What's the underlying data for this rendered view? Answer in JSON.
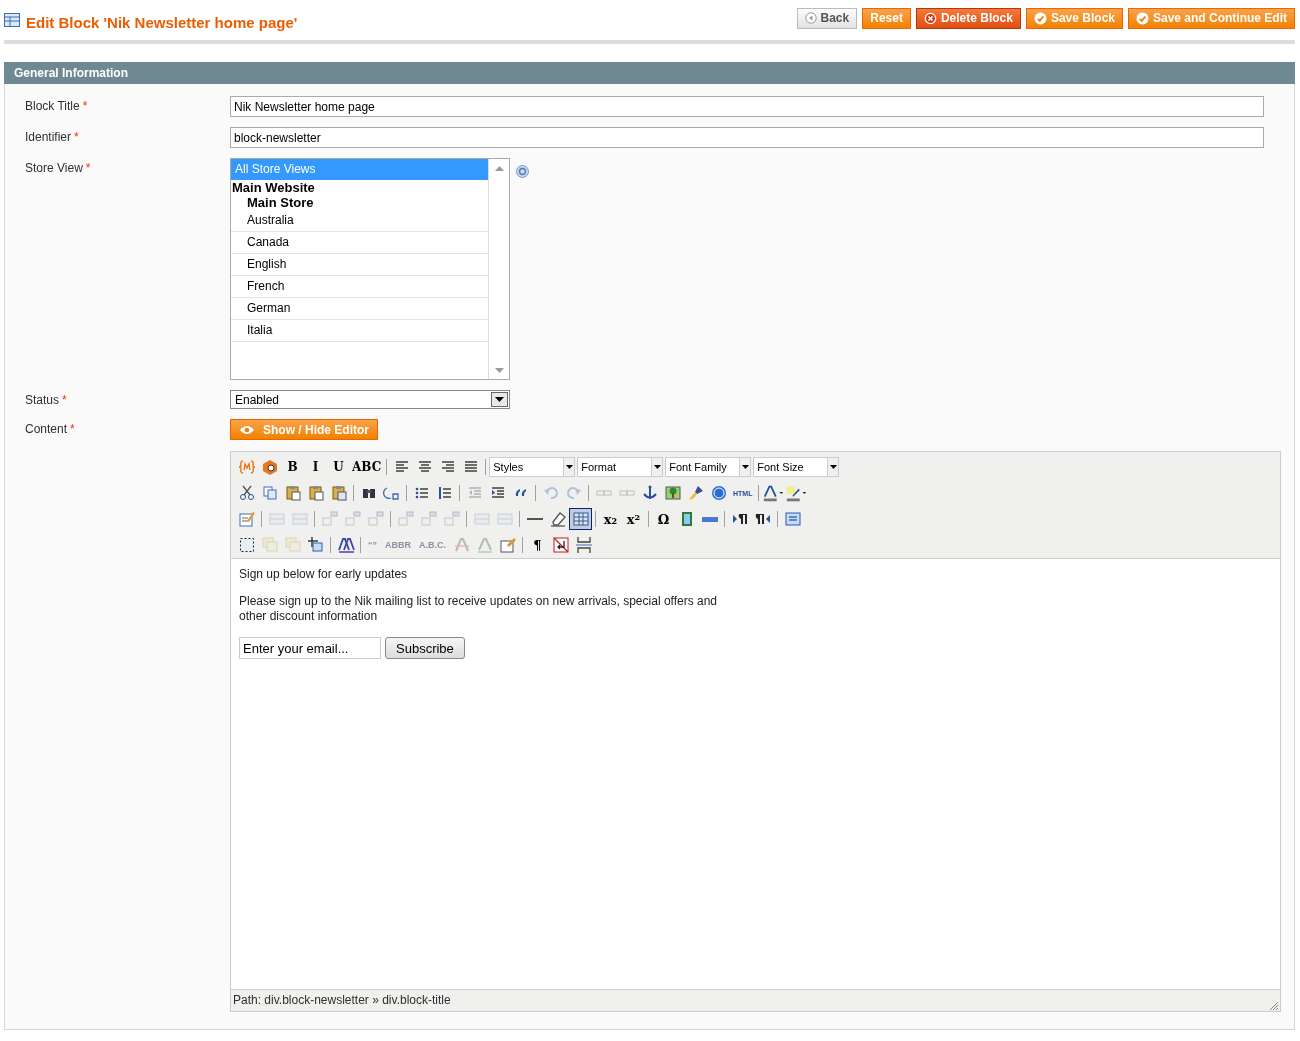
{
  "header": {
    "title": "Edit Block 'Nik Newsletter home page'",
    "buttons": [
      {
        "kind": "back",
        "label": "Back"
      },
      {
        "kind": "plain",
        "label": "Reset"
      },
      {
        "kind": "delete",
        "label": "Delete Block"
      },
      {
        "kind": "save",
        "label": "Save Block"
      },
      {
        "kind": "save",
        "label": "Save and Continue Edit"
      }
    ]
  },
  "section": {
    "title": "General Information"
  },
  "fields": [
    {
      "kind": "text",
      "label": "Block Title",
      "mark": "*",
      "value": "Nik Newsletter home page"
    },
    {
      "kind": "text",
      "label": "Identifier",
      "mark": "*",
      "value": "block-newsletter"
    },
    {
      "kind": "listbox",
      "label": "Store View",
      "mark": "*",
      "options": [
        {
          "label": "All Store Views",
          "selected": true
        },
        {
          "label": "Main Website",
          "children": [
            {
              "label": "Main Store",
              "children": [
                {
                  "label": "Australia",
                  "selected": false
                },
                {
                  "label": "Canada",
                  "selected": false
                },
                {
                  "label": "English",
                  "selected": false
                },
                {
                  "label": "French",
                  "selected": false
                },
                {
                  "label": "German",
                  "selected": false
                },
                {
                  "label": "Italia",
                  "selected": false
                }
              ]
            }
          ]
        }
      ]
    },
    {
      "kind": "select",
      "label": "Status",
      "mark": "*",
      "value": "Enabled"
    },
    {
      "kind": "editor",
      "label": "Content",
      "mark": "*",
      "toggle": "Show / Hide Editor"
    }
  ],
  "editor": {
    "toolbar": [
      [
        {
          "kind": "icon",
          "disabled": false
        },
        {
          "kind": "icon",
          "disabled": false
        },
        {
          "kind": "glyph",
          "label": "B",
          "disabled": false
        },
        {
          "kind": "glyph",
          "label": "I",
          "disabled": false
        },
        {
          "kind": "glyph",
          "label": "U",
          "disabled": false
        },
        {
          "kind": "glyph",
          "label": "ABC",
          "disabled": false
        },
        {
          "kind": "sep"
        },
        {
          "kind": "icon",
          "disabled": false
        },
        {
          "kind": "icon",
          "disabled": false
        },
        {
          "kind": "icon",
          "disabled": false
        },
        {
          "kind": "icon",
          "disabled": false
        },
        {
          "kind": "sep"
        },
        {
          "kind": "select",
          "label": "Styles"
        },
        {
          "kind": "select",
          "label": "Format"
        },
        {
          "kind": "select",
          "label": "Font Family"
        },
        {
          "kind": "select",
          "label": "Font Size"
        }
      ],
      [
        {
          "kind": "icon",
          "disabled": false
        },
        {
          "kind": "icon",
          "disabled": false
        },
        {
          "kind": "icon",
          "disabled": false
        },
        {
          "kind": "icon",
          "disabled": false
        },
        {
          "kind": "icon",
          "disabled": false
        },
        {
          "kind": "sep"
        },
        {
          "kind": "icon",
          "disabled": false
        },
        {
          "kind": "icon",
          "disabled": false
        },
        {
          "kind": "sep"
        },
        {
          "kind": "icon",
          "disabled": false
        },
        {
          "kind": "icon",
          "disabled": false
        },
        {
          "kind": "sep"
        },
        {
          "kind": "icon",
          "disabled": true
        },
        {
          "kind": "icon",
          "disabled": false
        },
        {
          "kind": "icon",
          "disabled": false
        },
        {
          "kind": "sep"
        },
        {
          "kind": "icon",
          "disabled": true
        },
        {
          "kind": "icon",
          "disabled": true
        },
        {
          "kind": "sep"
        },
        {
          "kind": "icon",
          "disabled": true
        },
        {
          "kind": "icon",
          "disabled": true
        },
        {
          "kind": "icon",
          "disabled": false
        },
        {
          "kind": "icon",
          "disabled": false
        },
        {
          "kind": "icon",
          "disabled": false
        },
        {
          "kind": "icon",
          "disabled": false
        },
        {
          "kind": "glyph",
          "label": "HTML",
          "disabled": false
        },
        {
          "kind": "sep"
        },
        {
          "kind": "icon",
          "disabled": false
        },
        {
          "kind": "icon",
          "disabled": false
        }
      ],
      [
        {
          "kind": "icon",
          "disabled": false
        },
        {
          "kind": "sep"
        },
        {
          "kind": "icon",
          "disabled": true
        },
        {
          "kind": "icon",
          "disabled": true
        },
        {
          "kind": "sep"
        },
        {
          "kind": "icon",
          "disabled": true
        },
        {
          "kind": "icon",
          "disabled": true
        },
        {
          "kind": "icon",
          "disabled": true
        },
        {
          "kind": "sep"
        },
        {
          "kind": "icon",
          "disabled": true
        },
        {
          "kind": "icon",
          "disabled": true
        },
        {
          "kind": "icon",
          "disabled": true
        },
        {
          "kind": "sep"
        },
        {
          "kind": "icon",
          "disabled": true
        },
        {
          "kind": "icon",
          "disabled": true
        },
        {
          "kind": "sep"
        },
        {
          "kind": "icon",
          "disabled": false
        },
        {
          "kind": "icon",
          "disabled": false
        },
        {
          "kind": "icon",
          "disabled": false,
          "active": true
        },
        {
          "kind": "sep"
        },
        {
          "kind": "glyph",
          "label": "x₂",
          "disabled": false
        },
        {
          "kind": "glyph",
          "label": "x²",
          "disabled": false
        },
        {
          "kind": "sep"
        },
        {
          "kind": "glyph",
          "label": "Ω",
          "disabled": false
        },
        {
          "kind": "icon",
          "disabled": false
        },
        {
          "kind": "icon",
          "disabled": false
        },
        {
          "kind": "sep"
        },
        {
          "kind": "icon",
          "disabled": false
        },
        {
          "kind": "icon",
          "disabled": false
        },
        {
          "kind": "sep"
        },
        {
          "kind": "icon",
          "disabled": false
        }
      ],
      [
        {
          "kind": "icon",
          "disabled": false
        },
        {
          "kind": "icon",
          "disabled": true
        },
        {
          "kind": "icon",
          "disabled": true
        },
        {
          "kind": "icon",
          "disabled": false
        },
        {
          "kind": "sep"
        },
        {
          "kind": "icon",
          "disabled": false
        },
        {
          "kind": "sep"
        },
        {
          "kind": "glyph",
          "label": "“”",
          "disabled": true
        },
        {
          "kind": "glyph",
          "label": "ABBR",
          "disabled": true
        },
        {
          "kind": "glyph",
          "label": "A.B.C.",
          "disabled": true
        },
        {
          "kind": "icon",
          "disabled": true
        },
        {
          "kind": "icon",
          "disabled": true
        },
        {
          "kind": "icon",
          "disabled": false
        },
        {
          "kind": "sep"
        },
        {
          "kind": "glyph",
          "label": "¶",
          "disabled": false
        },
        {
          "kind": "icon",
          "disabled": false
        },
        {
          "kind": "icon",
          "disabled": false
        }
      ]
    ],
    "content": {
      "heading": "Sign up below for early updates",
      "paragraph": "Please sign up to the Nik mailing list to receive updates on new arrivals, special offers and other discount information",
      "email": "Enter your email...",
      "button": "Subscribe"
    },
    "path": "Path: div.block-newsletter » div.block-title"
  }
}
